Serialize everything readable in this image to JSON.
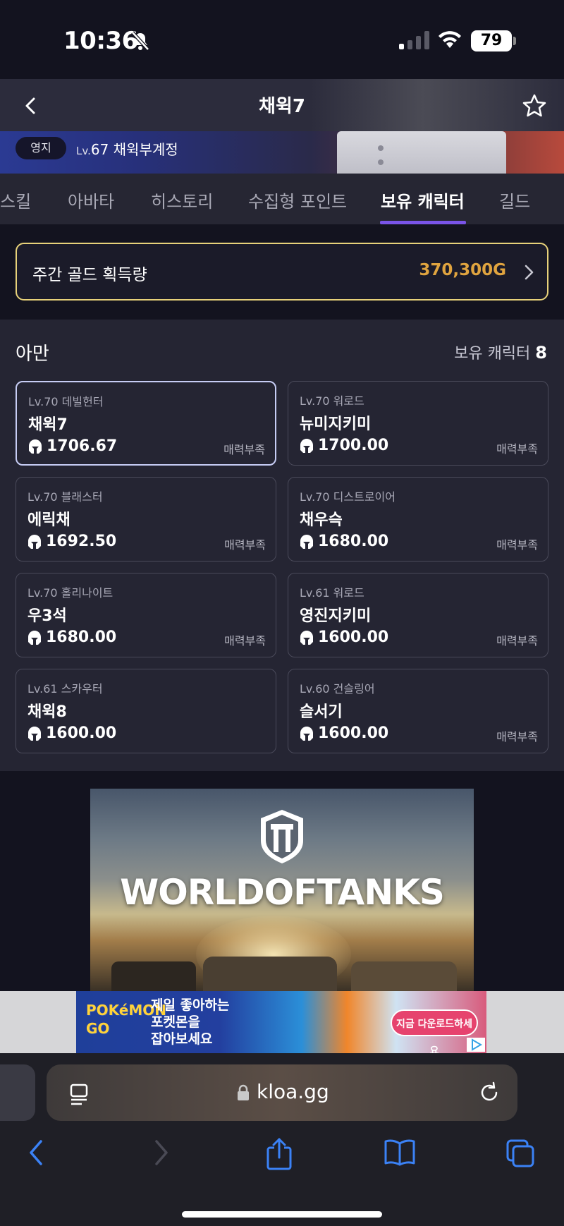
{
  "status_bar": {
    "time": "10:36",
    "battery": "79"
  },
  "header": {
    "title": "채윅7",
    "territory_label": "영지",
    "level_prefix": "Lv.",
    "level_value": "67",
    "account_name": "채윅부계정"
  },
  "tabs": [
    {
      "label": "스킬"
    },
    {
      "label": "아바타"
    },
    {
      "label": "히스토리"
    },
    {
      "label": "수집형 포인트"
    },
    {
      "label": "보유 캐릭터",
      "active": true
    },
    {
      "label": "길드"
    }
  ],
  "gold": {
    "label": "주간 골드 획득량",
    "value": "370,300G"
  },
  "server": {
    "name": "아만",
    "count_label": "보유 캐릭터",
    "count": "8",
    "characters": [
      {
        "class": "Lv.70 데빌헌터",
        "name": "채윅7",
        "item_level": "1706.67",
        "tag": "매력부족",
        "selected": true
      },
      {
        "class": "Lv.70 워로드",
        "name": "뉴미지키미",
        "item_level": "1700.00",
        "tag": "매력부족"
      },
      {
        "class": "Lv.70 블래스터",
        "name": "에릭채",
        "item_level": "1692.50",
        "tag": "매력부족"
      },
      {
        "class": "Lv.70 디스트로이어",
        "name": "채우슥",
        "item_level": "1680.00",
        "tag": "매력부족"
      },
      {
        "class": "Lv.70 홀리나이트",
        "name": "우3석",
        "item_level": "1680.00",
        "tag": "매력부족"
      },
      {
        "class": "Lv.61 워로드",
        "name": "영진지키미",
        "item_level": "1600.00",
        "tag": "매력부족"
      },
      {
        "class": "Lv.61 스카우터",
        "name": "채윅8",
        "item_level": "1600.00",
        "tag": ""
      },
      {
        "class": "Lv.60 건슬링어",
        "name": "슬서기",
        "item_level": "1600.00",
        "tag": "매력부족"
      }
    ]
  },
  "ads": {
    "wot_brand": "WORLDOFTANKS",
    "pogo_logo_line1": "POKéMON",
    "pogo_logo_line2": "GO",
    "pogo_line1": "제일 좋아하는",
    "pogo_line2": "포켓몬을",
    "pogo_line3": "잡아보세요",
    "pogo_cta": "지금 다운로드하세요"
  },
  "browser": {
    "url": "kloa.gg"
  },
  "colors": {
    "accent": "#7a54e8",
    "gold": "#e0a43f",
    "gold_border": "#e8d27a",
    "ios_blue": "#3b82f6"
  }
}
